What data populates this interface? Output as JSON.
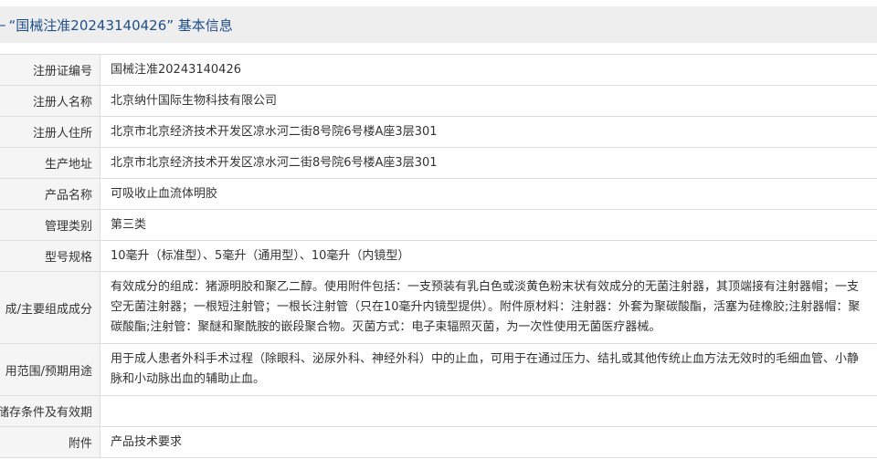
{
  "header": {
    "collapse_icon": "–",
    "title": "“国械注准20243140426” 基本信息"
  },
  "rows": [
    {
      "label": "注册证编号",
      "value": "国械注准20243140426"
    },
    {
      "label": "注册人名称",
      "value": "北京纳什国际生物科技有限公司"
    },
    {
      "label": "注册人住所",
      "value": "北京市北京经济技术开发区凉水河二街8号院6号楼A座3层301"
    },
    {
      "label": "生产地址",
      "value": "北京市北京经济技术开发区凉水河二街8号院6号楼A座3层301"
    },
    {
      "label": "产品名称",
      "value": "可吸收止血流体明胶"
    },
    {
      "label": "管理类别",
      "value": "第三类"
    },
    {
      "label": "型号规格",
      "value": "10毫升（标准型）、5毫升（通用型）、10毫升（内镜型）"
    },
    {
      "label": "成/主要组成成分",
      "value": "有效成分的组成：猪源明胶和聚乙二醇。使用附件包括：一支预装有乳白色或淡黄色粉末状有效成分的无菌注射器，其顶端接有注射器帽；一支空无菌注射器；一根短注射管；一根长注射管（只在10毫升内镜型提供）。附件原材料：注射器：外套为聚碳酸酯，活塞为硅橡胶;注射器帽：聚碳酸酯;注射管：聚醚和聚酰胺的嵌段聚合物。灭菌方式：电子束辐照灭菌，为一次性使用无菌医疗器械。"
    },
    {
      "label": "用范围/预期用途",
      "value": "用于成人患者外科手术过程（除眼科、泌尿外科、神经外科）中的止血，可用于在通过压力、结扎或其他传统止血方法无效时的毛细血管、小静脉和小动脉出血的辅助止血。"
    },
    {
      "label": "储存条件及有效期",
      "value": ""
    },
    {
      "label": "附件",
      "value": "产品技术要求"
    }
  ]
}
